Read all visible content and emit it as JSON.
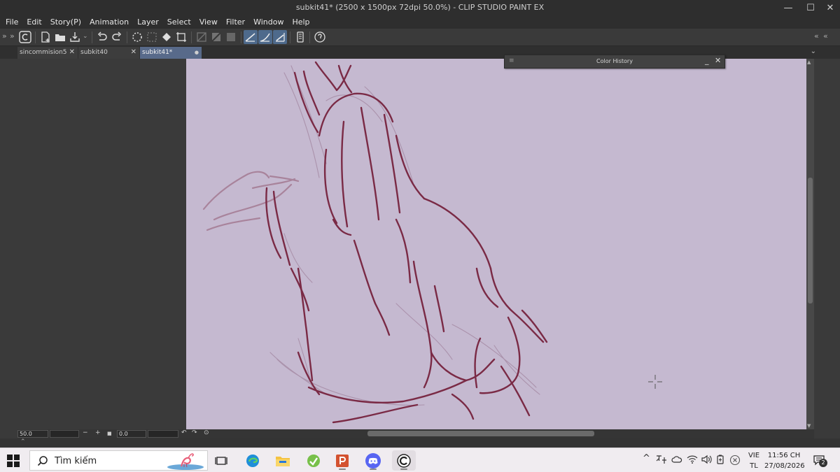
{
  "window": {
    "title": "subkit41* (2500 x 1500px 72dpi 50.0%)  - CLIP STUDIO PAINT EX",
    "minimize": "—",
    "restore": "☐",
    "close": "✕"
  },
  "menu": [
    "File",
    "Edit",
    "Story(P)",
    "Animation",
    "Layer",
    "Select",
    "View",
    "Filter",
    "Window",
    "Help"
  ],
  "toolbar": {
    "left_arrows": "»",
    "right_arrows": "«",
    "icons": [
      "clip-studio-icon",
      "new-file-icon",
      "open-file-icon",
      "save-icon",
      "undo-icon",
      "redo-icon",
      "clear-icon",
      "clear-outside-icon",
      "fill-icon",
      "transform-icon",
      "deselect-icon",
      "invert-icon",
      "show-selection-icon",
      "snap-ruler-icon",
      "snap-special-icon",
      "snap-grid-icon",
      "device-icon",
      "help-icon"
    ]
  },
  "tabs": [
    {
      "label": "sincommision5",
      "close": "✕"
    },
    {
      "label": "subkit40",
      "close": "✕"
    },
    {
      "label": "subkit41*",
      "close": "●"
    }
  ],
  "tab_menu": "⌄",
  "color_history": {
    "title": "Color History",
    "grip": "≡",
    "minimize": "_",
    "close": "✕"
  },
  "status": {
    "zoom": "50.0",
    "minus": "−",
    "plus": "+",
    "stop": "■",
    "rotation": "0.0"
  },
  "colors": {
    "canvas": "#c5b9d0",
    "sketch_dark": "#7a2a45",
    "sketch_light": "#a47a92",
    "ui_dark": "#3a3a3a",
    "accent": "#586a8a"
  },
  "taskbar": {
    "search_placeholder": "Tìm kiếm",
    "apps": [
      "task-view-icon",
      "edge-icon",
      "file-explorer-icon",
      "csp-launcher-icon",
      "powerpoint-icon",
      "discord-icon",
      "clip-studio-paint-icon"
    ],
    "tray": {
      "chevron": "^",
      "language_top": "VIE",
      "language_bottom": "TL",
      "time": "11:56 CH",
      "date": "27/08/2026",
      "notifications": "2"
    }
  }
}
